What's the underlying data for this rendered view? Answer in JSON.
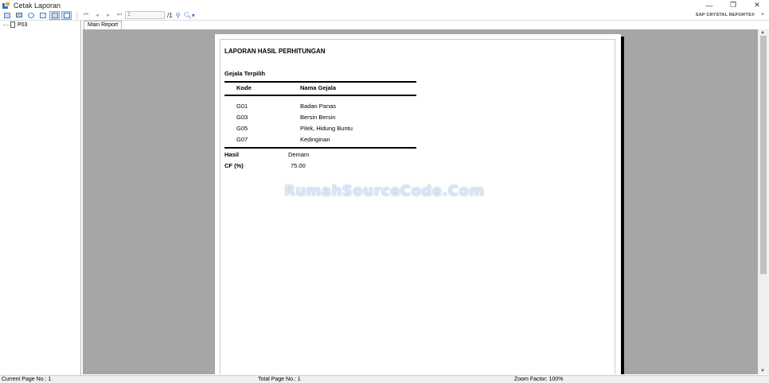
{
  "window": {
    "title": "Cetak Laporan",
    "controls": {
      "minimize": "—",
      "restore": "❐",
      "close": "✕"
    }
  },
  "toolbar": {
    "page_number": "1",
    "page_total": "/1",
    "brand": "SAP CRYSTAL REPORTS®",
    "nav_first": "⏮",
    "nav_prev": "◂",
    "nav_next": "▸",
    "nav_last": "⏭"
  },
  "tree": {
    "nodes": [
      {
        "label": "P03"
      }
    ]
  },
  "tabs": [
    {
      "label": "Main Report"
    }
  ],
  "report": {
    "title": "LAPORAN HASIL PERHITUNGAN",
    "section_title": "Gejala Terpilih",
    "columns": {
      "kode": "Kode",
      "nama": "Nama Gejala"
    },
    "rows": [
      {
        "kode": "G01",
        "nama": "Badan Panas"
      },
      {
        "kode": "G03",
        "nama": "Bersin Bersin"
      },
      {
        "kode": "G05",
        "nama": "Pilek, Hidung Buntu"
      },
      {
        "kode": "G07",
        "nama": "Kedinginan"
      }
    ],
    "hasil_label": "Hasil",
    "hasil_value": "Demam",
    "cf_label": "CF (%)",
    "cf_value": "75.00",
    "watermark": "RumahSourceCode.Com"
  },
  "status": {
    "current_page": "Current Page No.: 1",
    "total_page": "Total Page No.: 1",
    "zoom": "Zoom Factor: 100%"
  }
}
